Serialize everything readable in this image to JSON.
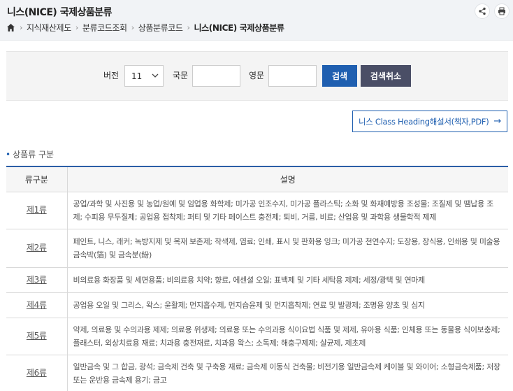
{
  "header": {
    "title": "니스(NICE) 국제상품분류",
    "breadcrumb": [
      "지식재산제도",
      "분류코드조회",
      "상품분류코드",
      "니스(NICE) 국제상품분류"
    ],
    "icons": [
      "home-icon",
      "share-icon",
      "print-icon"
    ]
  },
  "search": {
    "version_label": "버전",
    "version_value": "11",
    "kr_label": "국문",
    "kr_value": "",
    "en_label": "영문",
    "en_value": "",
    "search_button": "검색",
    "cancel_button": "검색취소"
  },
  "pdf_button": {
    "label": "니스 Class Heading해설서(책자,PDF)",
    "arrow": "→"
  },
  "section": {
    "title": "상품류 구분"
  },
  "table": {
    "headers": [
      "류구분",
      "설명"
    ],
    "rows": [
      {
        "cat": "제1류",
        "desc": "공업/과학 및 사진용 및 농업/원예 및 임업용 화학제; 미가공 인조수지, 미가공 플라스틱; 소화 및 화재예방용 조성물; 조질제 및 땜납용 조제; 수피용 무두질제; 공업용 접착제; 퍼티 및 기타 페이스트 충전제; 퇴비, 거름, 비료; 산업용 및 과학용 생물학적 제제"
      },
      {
        "cat": "제2류",
        "desc": "페인트, 니스, 래커; 녹방지제 및 목재 보존제; 착색제, 염료; 인쇄, 표시 및 판화용 잉크; 미가공 천연수지; 도장용, 장식용, 인쇄용 및 미술용 금속박(箔) 및 금속분(紛)"
      },
      {
        "cat": "제3류",
        "desc": "비의료용 화장품 및 세면용품; 비의료용 치약; 향료, 에센셜 오일; 표백제 및 기타 세탁용 제제; 세정/광택 및 연마제"
      },
      {
        "cat": "제4류",
        "desc": "공업용 오일 및 그리스, 왁스; 윤활제; 먼지흡수제, 먼지습윤제 및 먼지흡착제; 연료 및 발광제; 조명용 양초 및 심지"
      },
      {
        "cat": "제5류",
        "desc": "약제, 의료용 및 수의과용 제제; 의료용 위생제; 의료용 또는 수의과용 식이요법 식품 및 제제, 유아용 식품; 인체용 또는 동물용 식이보충제; 플래스터, 외상치료용 재료; 치과용 충전재료, 치과용 왁스; 소독제; 해충구제제; 살균제, 제초제"
      },
      {
        "cat": "제6류",
        "desc": "일반금속 및 그 합금, 광석; 금속제 건축 및 구축용 재료; 금속제 이동식 건축물; 비전기용 일반금속제 케이블 및 와이어; 소형금속제품; 저장 또는 운반용 금속제 용기; 금고"
      }
    ]
  }
}
